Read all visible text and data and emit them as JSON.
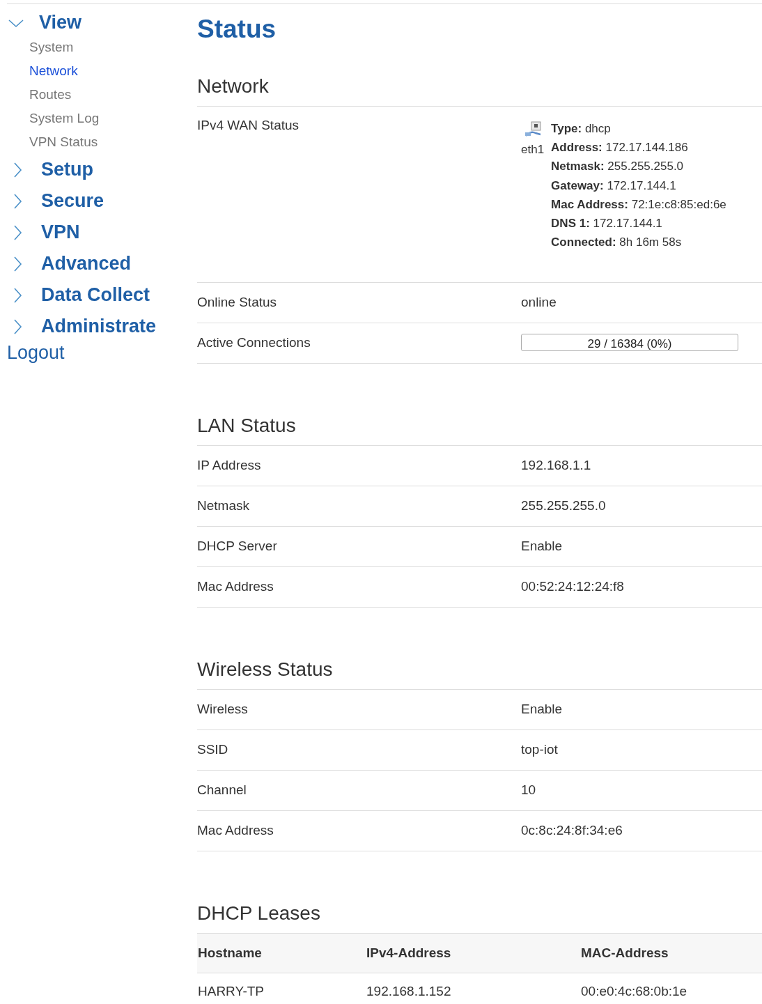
{
  "sidebar": {
    "groups": [
      {
        "label": "View",
        "expanded": true,
        "items": [
          {
            "label": "System",
            "selected": false
          },
          {
            "label": "Network",
            "selected": true
          },
          {
            "label": "Routes",
            "selected": false
          },
          {
            "label": "System Log",
            "selected": false
          },
          {
            "label": "VPN Status",
            "selected": false
          }
        ]
      },
      {
        "label": "Setup",
        "expanded": false
      },
      {
        "label": "Secure",
        "expanded": false
      },
      {
        "label": "VPN",
        "expanded": false
      },
      {
        "label": "Advanced",
        "expanded": false
      },
      {
        "label": "Data Collect",
        "expanded": false
      },
      {
        "label": "Administrate",
        "expanded": false
      }
    ],
    "logout": "Logout"
  },
  "main": {
    "title": "Status",
    "sections": [
      {
        "title": "Network",
        "rows": [
          {
            "kind": "wan",
            "label": "IPv4 WAN Status",
            "interface": "eth1",
            "fields": [
              {
                "key": "Type:",
                "value": "dhcp"
              },
              {
                "key": "Address:",
                "value": "172.17.144.186"
              },
              {
                "key": "Netmask:",
                "value": "255.255.255.0"
              },
              {
                "key": "Gateway:",
                "value": "172.17.144.1"
              },
              {
                "key": "Mac Address:",
                "value": "72:1e:c8:85:ed:6e"
              },
              {
                "key": "DNS 1:",
                "value": "172.17.144.1"
              },
              {
                "key": "Connected:",
                "value": "8h 16m 58s"
              }
            ]
          },
          {
            "kind": "text",
            "label": "Online Status",
            "value": "online"
          },
          {
            "kind": "meter",
            "label": "Active Connections",
            "value": "29 / 16384 (0%)",
            "level": 0
          }
        ]
      },
      {
        "title": "LAN Status",
        "rows": [
          {
            "kind": "text",
            "label": "IP Address",
            "value": "192.168.1.1"
          },
          {
            "kind": "text",
            "label": "Netmask",
            "value": "255.255.255.0"
          },
          {
            "kind": "text",
            "label": "DHCP Server",
            "value": "Enable"
          },
          {
            "kind": "text",
            "label": "Mac Address",
            "value": "00:52:24:12:24:f8"
          }
        ]
      },
      {
        "title": "Wireless Status",
        "rows": [
          {
            "kind": "text",
            "label": "Wireless",
            "value": "Enable"
          },
          {
            "kind": "text",
            "label": "SSID",
            "value": "top-iot"
          },
          {
            "kind": "text",
            "label": "Channel",
            "value": "10"
          },
          {
            "kind": "text",
            "label": "Mac Address",
            "value": "0c:8c:24:8f:34:e6"
          }
        ]
      }
    ],
    "dhcp": {
      "title": "DHCP Leases",
      "columns": [
        "Hostname",
        "IPv4-Address",
        "MAC-Address"
      ],
      "rows": [
        [
          "HARRY-TP",
          "192.168.1.152",
          "00:e0:4c:68:0b:1e"
        ]
      ]
    }
  }
}
